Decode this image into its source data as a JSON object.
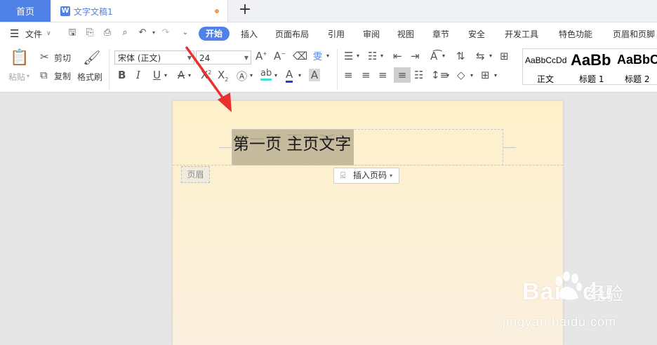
{
  "titlebar": {
    "home_tab": "首页",
    "doc_icon": "W",
    "doc_title": "文字文稿1",
    "new_tab": "+"
  },
  "menubar": {
    "file": "文件",
    "tabs": [
      "开始",
      "插入",
      "页面布局",
      "引用",
      "审阅",
      "视图",
      "章节",
      "安全",
      "开发工具",
      "特色功能",
      "页眉和页脚"
    ],
    "active_tab": "开始"
  },
  "ribbon": {
    "paste": "粘贴",
    "cut": "剪切",
    "copy": "复制",
    "format_painter": "格式刷",
    "font_name": "宋体 (正文)",
    "font_size": "24",
    "styles": [
      {
        "sample": "AaBbCcDd",
        "name": "正文"
      },
      {
        "sample": "AaBb",
        "name": "标题 1"
      },
      {
        "sample": "AaBbC",
        "name": "标题 2"
      }
    ]
  },
  "document": {
    "header_text": "第一页  主页文字",
    "header_label": "页眉",
    "insert_page_number": "插入页码"
  },
  "watermark": {
    "brand": "Bai",
    "brand_suffix": "du",
    "cn": "经验",
    "url": "jingyan.baidu.com"
  },
  "colors": {
    "accent": "#4f81e6",
    "page_bg": "#fdf0c9",
    "arrow": "#e8312f"
  }
}
